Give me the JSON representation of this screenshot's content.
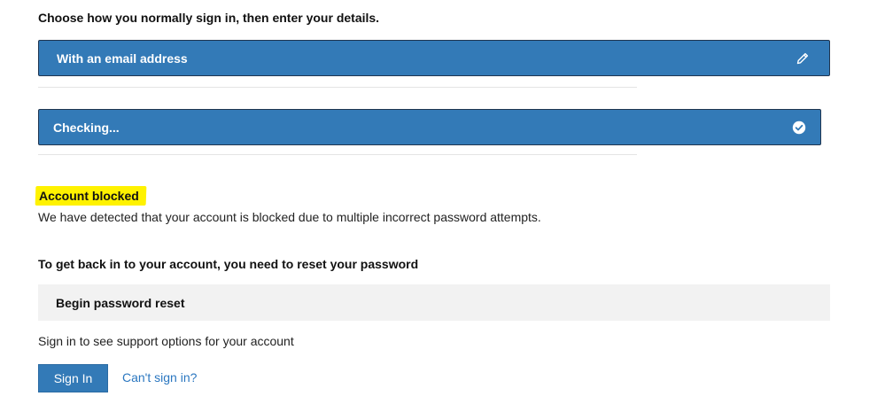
{
  "intro": "Choose how you normally sign in, then enter your details.",
  "methods": {
    "email_label": "With an email address",
    "checking_label": "Checking..."
  },
  "blocked": {
    "title": "Account blocked",
    "description": "We have detected that your account is blocked due to multiple incorrect password attempts."
  },
  "reset": {
    "heading": "To get back in to your account, you need to reset your password",
    "button_label": "Begin password reset"
  },
  "support": {
    "text": "Sign in to see support options for your account",
    "signin_label": "Sign In",
    "cant_signin_label": "Can't sign in?"
  },
  "colors": {
    "primary": "#337ab7",
    "highlight": "#fff200",
    "link": "#2b77c0",
    "reset_bg": "#f2f2f2"
  },
  "icons": {
    "edit": "pencil-icon",
    "status": "check-circle-icon"
  }
}
